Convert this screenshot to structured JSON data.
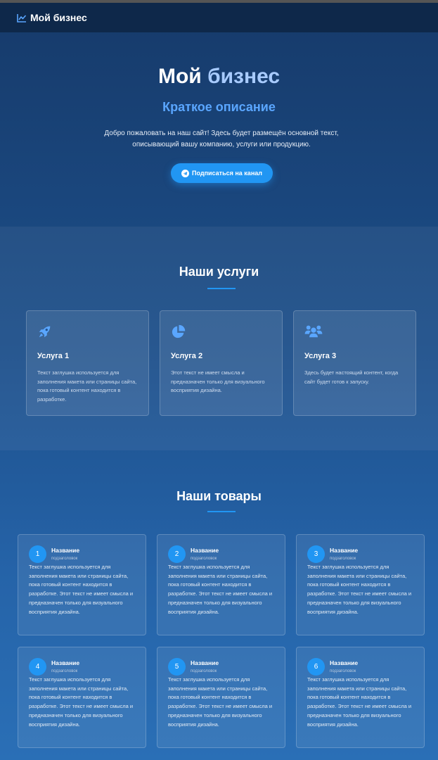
{
  "navbar": {
    "brand": "Мой бизнес"
  },
  "hero": {
    "title_part1": "Мой",
    "title_part2": "бизнес",
    "subtitle": "Краткое описание",
    "text": "Добро пожаловать на наш сайт! Здесь будет размещён основной текст, описывающий вашу компанию, услуги или продукцию.",
    "button_label": "Подписаться на канал"
  },
  "services": {
    "title": "Наши услуги",
    "items": [
      {
        "icon": "rocket-icon",
        "name": "Услуга 1",
        "text": "Текст заглушка используется для заполнения макета или страницы сайта, пока готовый контент находится в разработке."
      },
      {
        "icon": "pie-chart-icon",
        "name": "Услуга 2",
        "text": "Этот текст не имеет смысла и предназначен только для визуального восприятия дизайна."
      },
      {
        "icon": "users-icon",
        "name": "Услуга 3",
        "text": "Здесь будет настоящий контент, когда сайт будет готов к запуску."
      }
    ]
  },
  "products": {
    "title": "Наши товары",
    "items": [
      {
        "num": "1",
        "name": "Название",
        "subtitle": "подзаголовок",
        "text": "Текст заглушка используется для заполнения макета или страницы сайта, пока готовый контент находится в разработке. Этот текст не имеет смысла и предназначен только для визуального восприятия дизайна."
      },
      {
        "num": "2",
        "name": "Название",
        "subtitle": "подзаголовок",
        "text": "Текст заглушка используется для заполнения макета или страницы сайта, пока готовый контент находится в разработке. Этот текст не имеет смысла и предназначен только для визуального восприятия дизайна."
      },
      {
        "num": "3",
        "name": "Название",
        "subtitle": "подзаголовок",
        "text": "Текст заглушка используется для заполнения макета или страницы сайта, пока готовый контент находится в разработке. Этот текст не имеет смысла и предназначен только для визуального восприятия дизайна."
      },
      {
        "num": "4",
        "name": "Название",
        "subtitle": "подзаголовок",
        "text": "Текст заглушка используется для заполнения макета или страницы сайта, пока готовый контент находится в разработке. Этот текст не имеет смысла и предназначен только для визуального восприятия дизайна."
      },
      {
        "num": "5",
        "name": "Название",
        "subtitle": "подзаголовок",
        "text": "Текст заглушка используется для заполнения макета или страницы сайта, пока готовый контент находится в разработке. Этот текст не имеет смысла и предназначен только для визуального восприятия дизайна."
      },
      {
        "num": "6",
        "name": "Название",
        "subtitle": "подзаголовок",
        "text": "Текст заглушка используется для заполнения макета или страницы сайта, пока готовый контент находится в разработке. Этот текст не имеет смысла и предназначен только для визуального восприятия дизайна."
      }
    ]
  },
  "colors": {
    "accent": "#2196f3",
    "accent_light": "#5aa6ff",
    "background": "#1d4f8a"
  }
}
